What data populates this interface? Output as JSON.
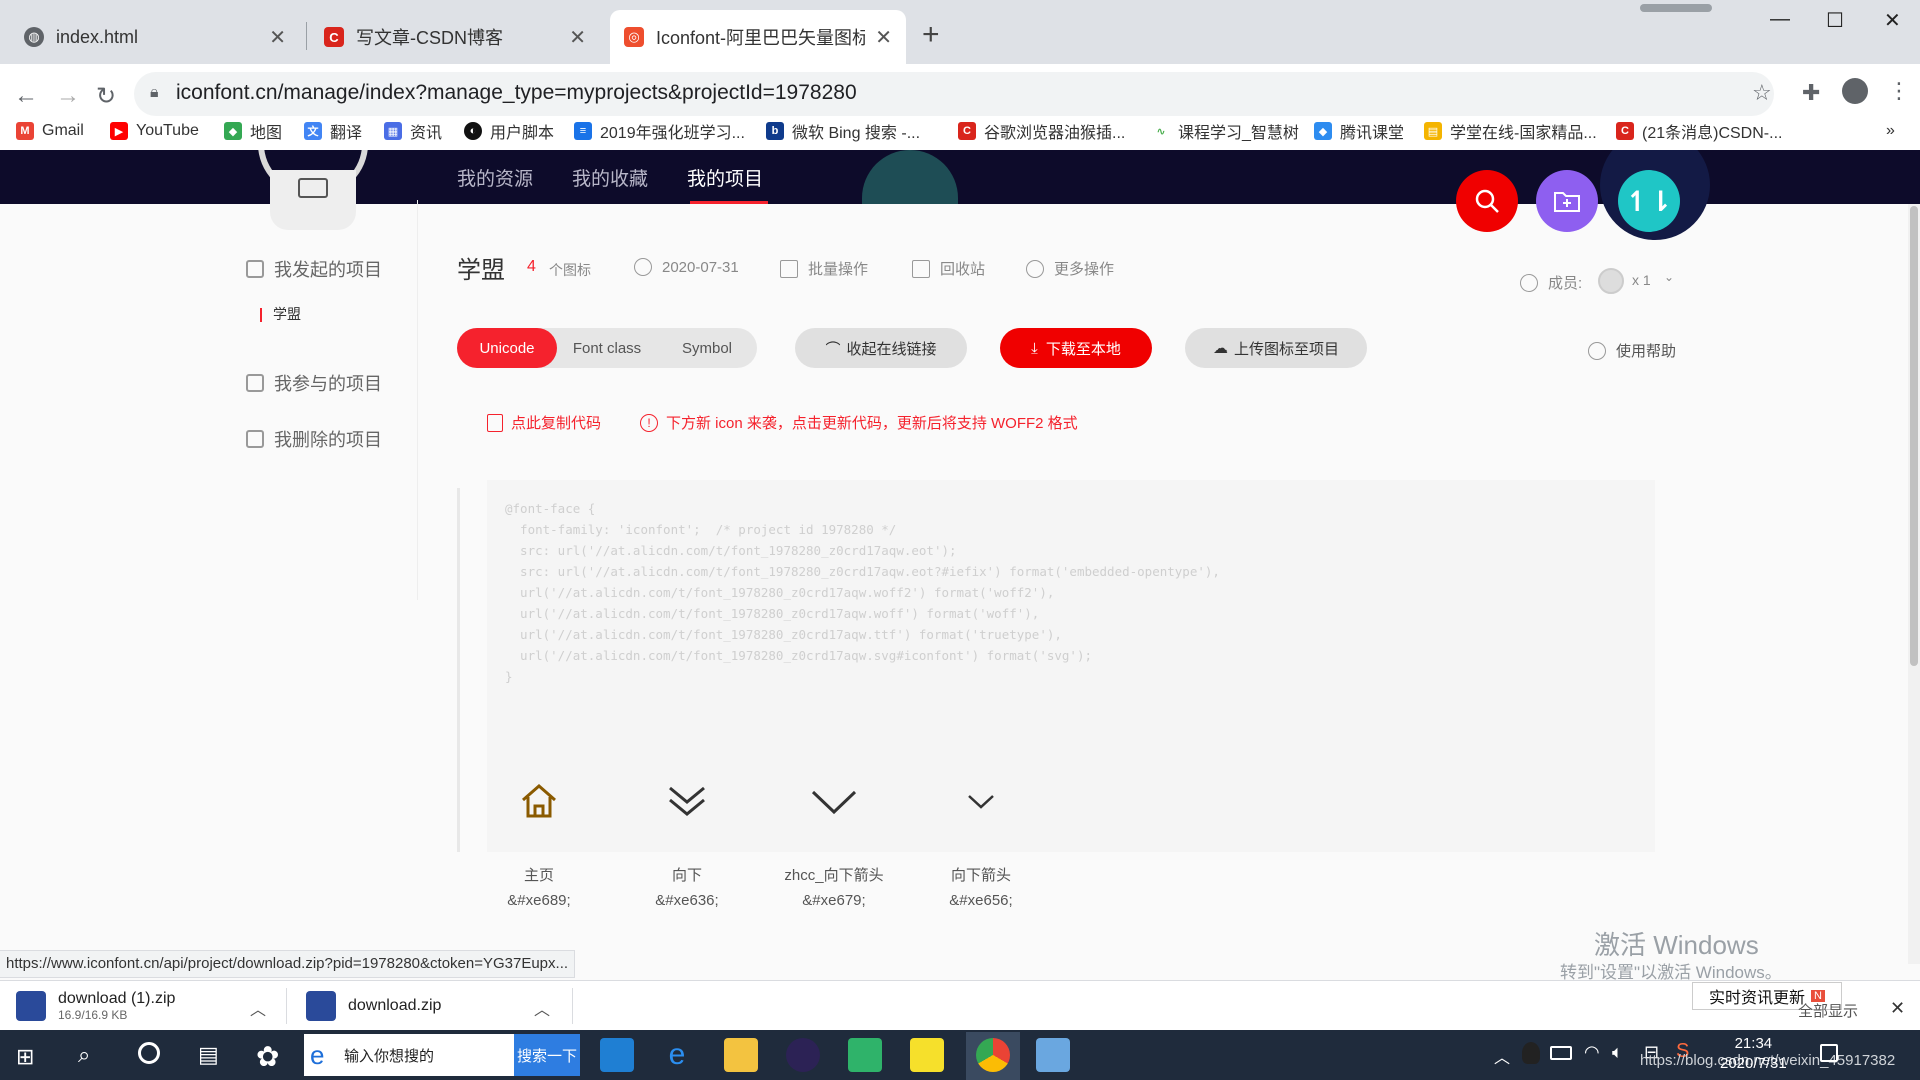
{
  "browser": {
    "tabs": [
      {
        "title": "index.html",
        "icon": "globe-icon"
      },
      {
        "title": "写文章-CSDN博客",
        "icon": "csdn-icon"
      },
      {
        "title": "Iconfont-阿里巴巴矢量图标库",
        "icon": "iconfont-icon"
      }
    ],
    "url": "iconfont.cn/manage/index?manage_type=myprojects&projectId=1978280",
    "bookmarks": [
      "Gmail",
      "YouTube",
      "地图",
      "翻译",
      "资讯",
      "用户脚本",
      "2019年强化班学习...",
      "微软 Bing 搜索 -...",
      "谷歌浏览器油猴插...",
      "课程学习_智慧树",
      "腾讯课堂",
      "学堂在线-国家精品...",
      "(21条消息)CSDN-..."
    ],
    "bookmarks_more": "»"
  },
  "nav": {
    "tabs": [
      "我的资源",
      "我的收藏",
      "我的项目"
    ],
    "active": "我的项目"
  },
  "sidebar": {
    "sections": [
      {
        "label": "我发起的项目",
        "icon": "document-edit-icon"
      },
      {
        "label": "学盟",
        "active": true
      },
      {
        "label": "我参与的项目",
        "icon": "document-user-icon"
      },
      {
        "label": "我删除的项目",
        "icon": "document-trash-icon"
      }
    ]
  },
  "project": {
    "name": "学盟",
    "icon_count": "4",
    "icon_count_unit": "个图标",
    "date": "2020-07-31",
    "batch": "批量操作",
    "recycle": "回收站",
    "more": "更多操作",
    "members_label": "成员:",
    "members_count": "x 1"
  },
  "toolbar": {
    "formats": [
      "Unicode",
      "Font class",
      "Symbol"
    ],
    "active_format": "Unicode",
    "collapse_link": "收起在线链接",
    "download": "下载至本地",
    "upload": "上传图标至项目",
    "help": "使用帮助"
  },
  "notice": {
    "copy": "点此复制代码",
    "update": "下方新 icon 来袭，点击更新代码，更新后将支持 WOFF2 格式"
  },
  "code_lines": [
    "@font-face {",
    "  font-family: 'iconfont';  /* project id 1978280 */",
    "  src: url('//at.alicdn.com/t/font_1978280_z0crd17aqw.eot');",
    "  src: url('//at.alicdn.com/t/font_1978280_z0crd17aqw.eot?#iefix') format('embedded-opentype'),",
    "  url('//at.alicdn.com/t/font_1978280_z0crd17aqw.woff2') format('woff2'),",
    "  url('//at.alicdn.com/t/font_1978280_z0crd17aqw.woff') format('woff'),",
    "  url('//at.alicdn.com/t/font_1978280_z0crd17aqw.ttf') format('truetype'),",
    "  url('//at.alicdn.com/t/font_1978280_z0crd17aqw.svg#iconfont') format('svg');",
    "}"
  ],
  "glyphs": [
    {
      "name": "主页",
      "code": "&#xe689;",
      "icon": "home-icon"
    },
    {
      "name": "向下",
      "code": "&#xe636;",
      "icon": "double-chevron-down-icon"
    },
    {
      "name": "zhcc_向下箭头",
      "code": "&#xe679;",
      "icon": "chevron-down-icon"
    },
    {
      "name": "向下箭头",
      "code": "&#xe656;",
      "icon": "small-chevron-down-icon"
    }
  ],
  "status_url": "https://www.iconfont.cn/api/project/download.zip?pid=1978280&ctoken=YG37Eupx...",
  "downloads": [
    {
      "name": "download (1).zip",
      "size": "16.9/16.9 KB"
    },
    {
      "name": "download.zip",
      "size": ""
    }
  ],
  "watermark": {
    "line1": "激活 Windows",
    "line2": "转到\"设置\"以激活 Windows。"
  },
  "news_button": "实时资讯更新",
  "news_side": "全部显示",
  "taskbar": {
    "search_placeholder": "输入你想搜的",
    "search_button": "搜索一下",
    "time": "21:34",
    "date": "2020/7/31",
    "blog_url": "https://blog.csdn.net/weixin_45917382"
  },
  "colors": {
    "accent": "#f5222d",
    "nav_bg": "#0d0b2a",
    "purple": "#8e5ff0",
    "teal": "#1fc6c6"
  }
}
